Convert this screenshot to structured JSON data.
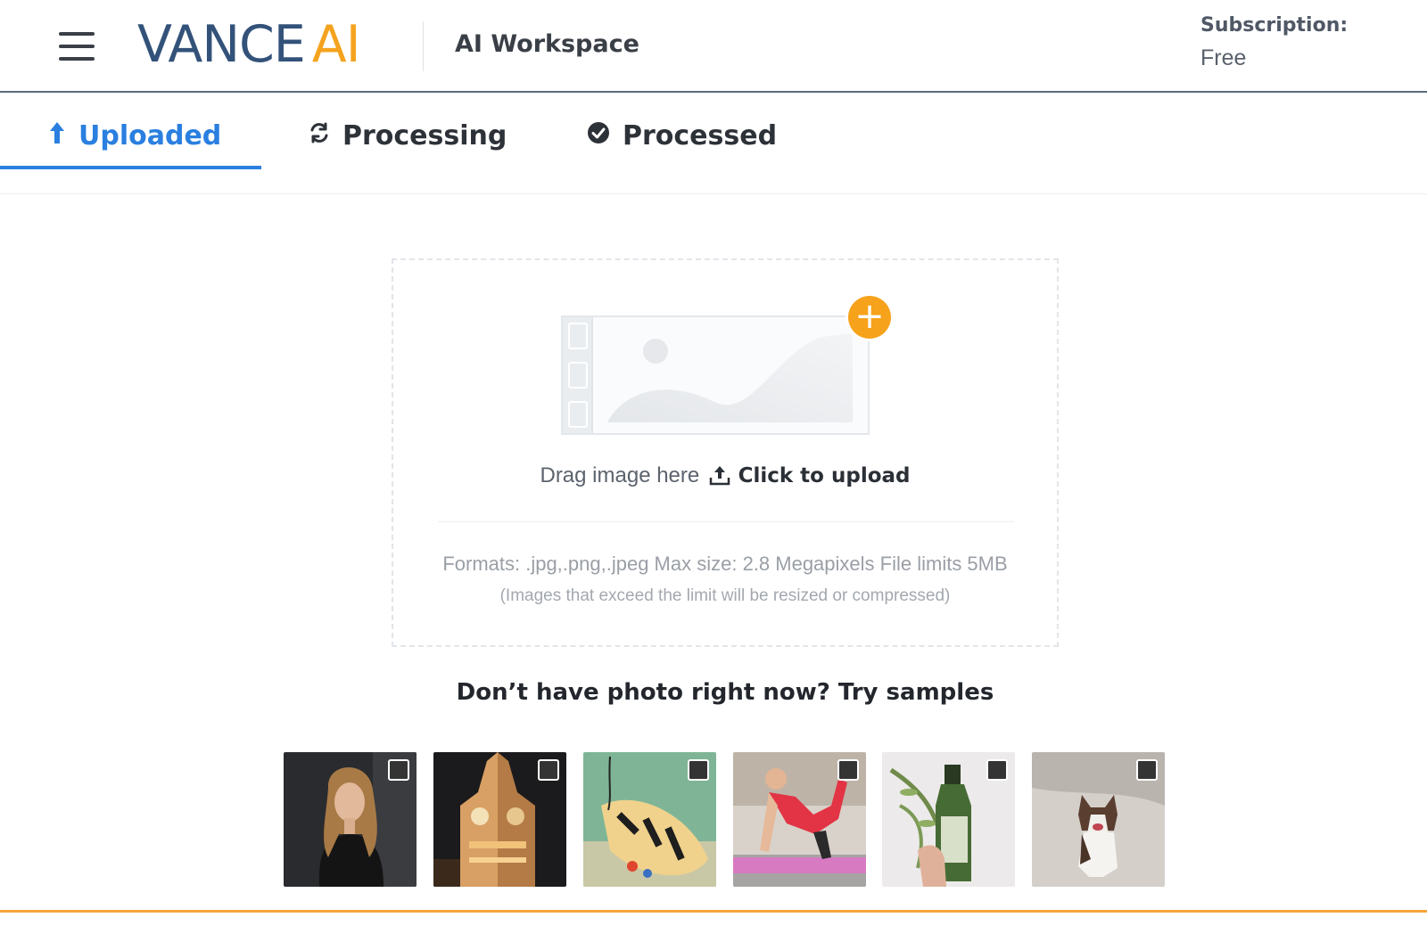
{
  "header": {
    "logo_brand": "VANCE",
    "logo_accent": "AI",
    "workspace_title": "AI Workspace",
    "subscription_label": "Subscription:",
    "subscription_value": "Free"
  },
  "tabs": [
    {
      "label": "Uploaded",
      "icon": "arrow-up-icon",
      "active": true
    },
    {
      "label": "Processing",
      "icon": "sync-icon",
      "active": false
    },
    {
      "label": "Processed",
      "icon": "check-circle-icon",
      "active": false
    }
  ],
  "upload": {
    "drag_text": "Drag image here",
    "cta_text": "Click to upload",
    "formats_text": "Formats: .jpg,.png,.jpeg Max size: 2.8 Megapixels File limits 5MB",
    "note_text": "(Images that exceed the limit will be resized or compressed)"
  },
  "samples": {
    "title": "Don’t have photo right now? Try samples",
    "items": [
      {
        "name": "sample-woman-portrait",
        "checked": false
      },
      {
        "name": "sample-clock-tower",
        "checked": false
      },
      {
        "name": "sample-butterfly",
        "checked": false
      },
      {
        "name": "sample-fitness-woman",
        "checked": false
      },
      {
        "name": "sample-green-bottle",
        "checked": false
      },
      {
        "name": "sample-running-dog",
        "checked": false
      }
    ]
  },
  "colors": {
    "brand_blue": "#33527a",
    "brand_orange": "#f5a31f",
    "active_tab": "#2a7fe0",
    "footer_line": "#f5a53a"
  }
}
